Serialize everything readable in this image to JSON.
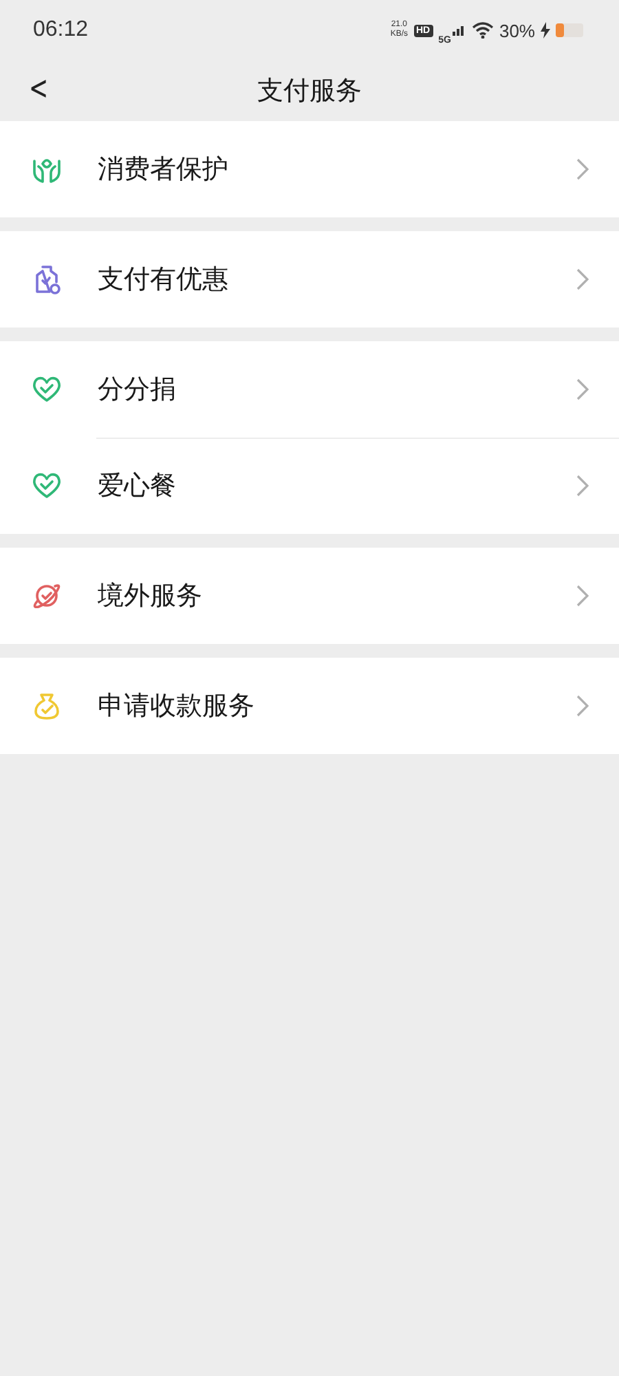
{
  "status_bar": {
    "time": "06:12",
    "speed_value": "21.0",
    "speed_unit": "KB/s",
    "hd": "HD",
    "network": "5G",
    "battery": "30%"
  },
  "header": {
    "back": "<",
    "title": "支付服务"
  },
  "groups": [
    {
      "items": [
        {
          "label": "消费者保护",
          "color": "#2fb877"
        }
      ]
    },
    {
      "items": [
        {
          "label": "支付有优惠",
          "color": "#7b72d8"
        }
      ]
    },
    {
      "items": [
        {
          "label": "分分捐",
          "color": "#2fb877"
        },
        {
          "label": "爱心餐",
          "color": "#2fb877"
        }
      ]
    },
    {
      "items": [
        {
          "label": "境外服务",
          "color": "#e06060"
        }
      ]
    },
    {
      "items": [
        {
          "label": "申请收款服务",
          "color": "#f0c832"
        }
      ]
    }
  ]
}
